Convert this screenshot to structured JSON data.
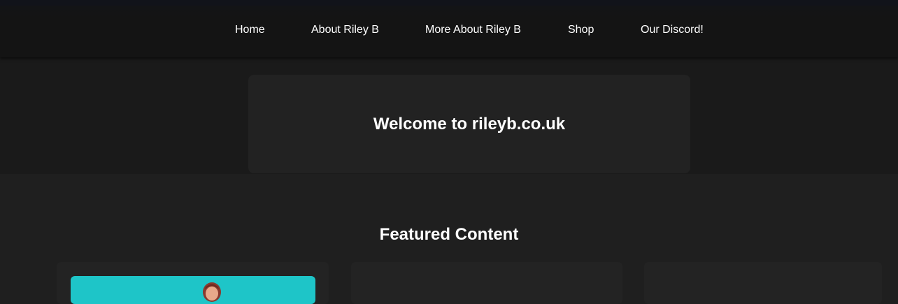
{
  "nav": {
    "items": [
      {
        "label": "Home"
      },
      {
        "label": "About Riley B"
      },
      {
        "label": "More About Riley B"
      },
      {
        "label": "Shop"
      },
      {
        "label": "Our Discord!"
      }
    ]
  },
  "hero": {
    "title": "Welcome to rileyb.co.uk"
  },
  "featured": {
    "title": "Featured Content"
  },
  "colors": {
    "background": "#1f1f1f",
    "navbar": "#141414",
    "card": "#222222",
    "accent_teal": "#1ec5c8"
  }
}
